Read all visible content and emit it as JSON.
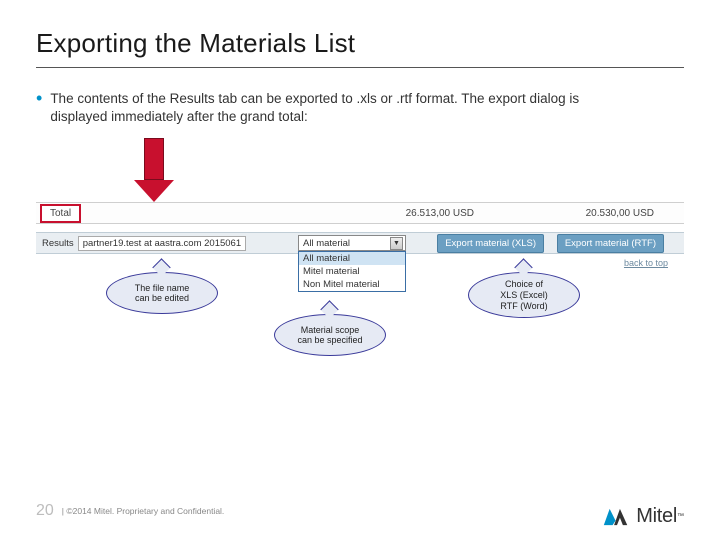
{
  "title": "Exporting the Materials List",
  "bullet1": "The contents of the Results tab can be exported to .xls or .rtf format. The export dialog is displayed immediately after the grand total:",
  "totals": {
    "label": "Total",
    "amount1": "26.513,00  USD",
    "amount2": "20.530,00  USD"
  },
  "export_row": {
    "results_label": "Results",
    "filename": "partner19.test at aastra.com 2015061",
    "dropdown_selected": "All material",
    "dropdown_options": [
      "All material",
      "Mitel material",
      "Non Mitel material"
    ],
    "btn_xls": "Export material (XLS)",
    "btn_rtf": "Export material (RTF)",
    "back_to_top": "back to top"
  },
  "callouts": {
    "filename": "The file name\ncan be edited",
    "scope": "Material scope\ncan be specified",
    "format": "Choice of\nXLS (Excel)\nRTF (Word)"
  },
  "footer": {
    "page": "20",
    "copyright": "| ©2014 Mitel. Proprietary and Confidential.",
    "brand": "Mitel"
  }
}
